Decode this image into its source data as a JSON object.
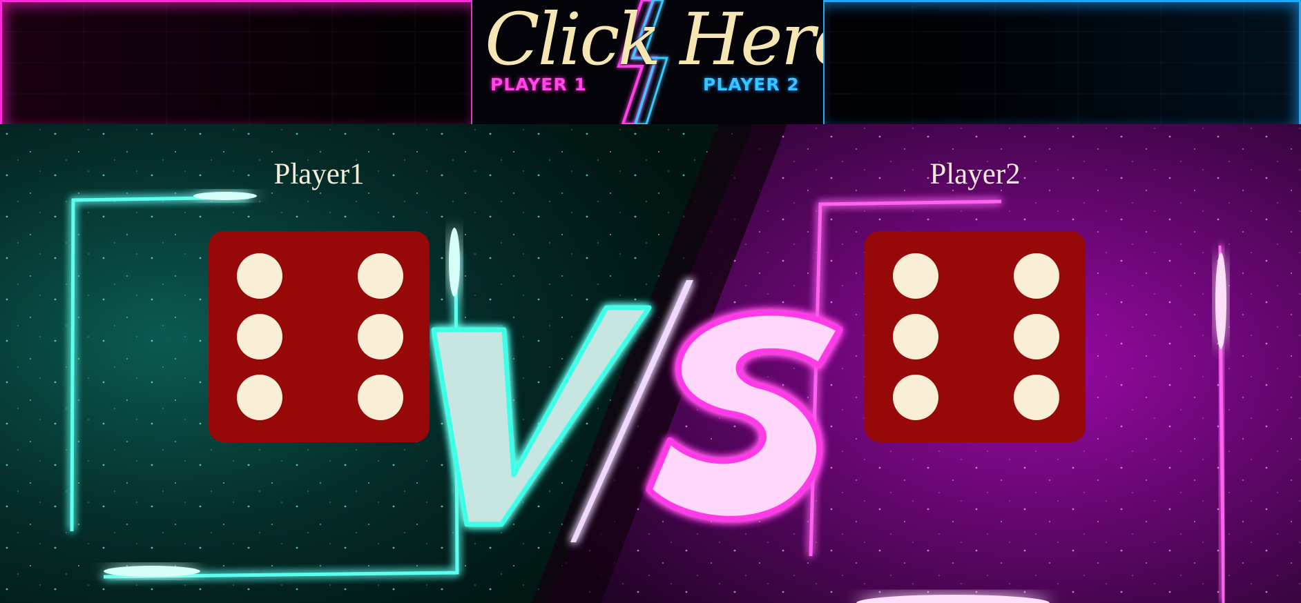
{
  "banner": {
    "button_script_text": "Click Here",
    "player1_label": "PLAYER 1",
    "player2_label": "PLAYER 2"
  },
  "arena": {
    "player1": {
      "name": "Player1",
      "die_value": 6
    },
    "player2": {
      "name": "Player2",
      "die_value": 6
    },
    "vs_text": "VS"
  },
  "colors": {
    "player1_neon": "#2ee6d6",
    "player2_neon": "#ff3ae8",
    "die_face": "#970808",
    "die_pip": "#f9eed6"
  }
}
